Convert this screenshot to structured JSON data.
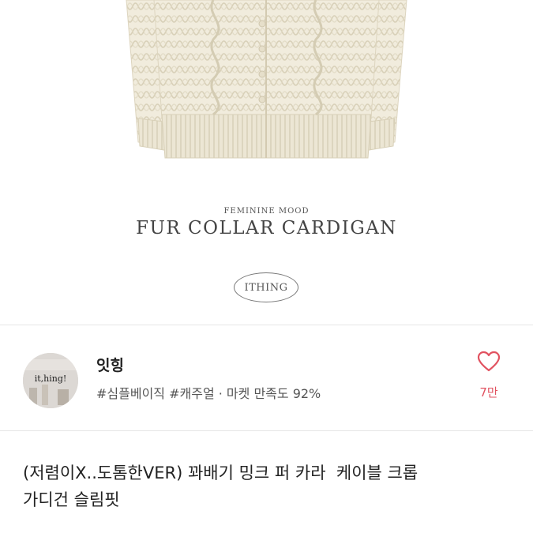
{
  "hero": {
    "mood_caption": "FEMININE MOOD",
    "product_title": "FUR COLLAR CARDIGAN",
    "brand_badge": "ITHING"
  },
  "shop": {
    "avatar_text": "it,hing!",
    "name": "잇힝",
    "tags": "#심플베이직 #캐주얼 · 마켓 만족도 92%",
    "like_count": "7만"
  },
  "listing": {
    "title_line1": "(저렴이X..도톰한VER) 꽈배기 밍크 퍼 카라  케이블 크롭",
    "title_line2": "가디건 슬림핏"
  },
  "colors": {
    "accent": "#e15260",
    "cardigan": "#f1ecdd",
    "text": "#222222",
    "muted": "#555555"
  },
  "icons": {
    "like": "heart-outline-icon"
  }
}
